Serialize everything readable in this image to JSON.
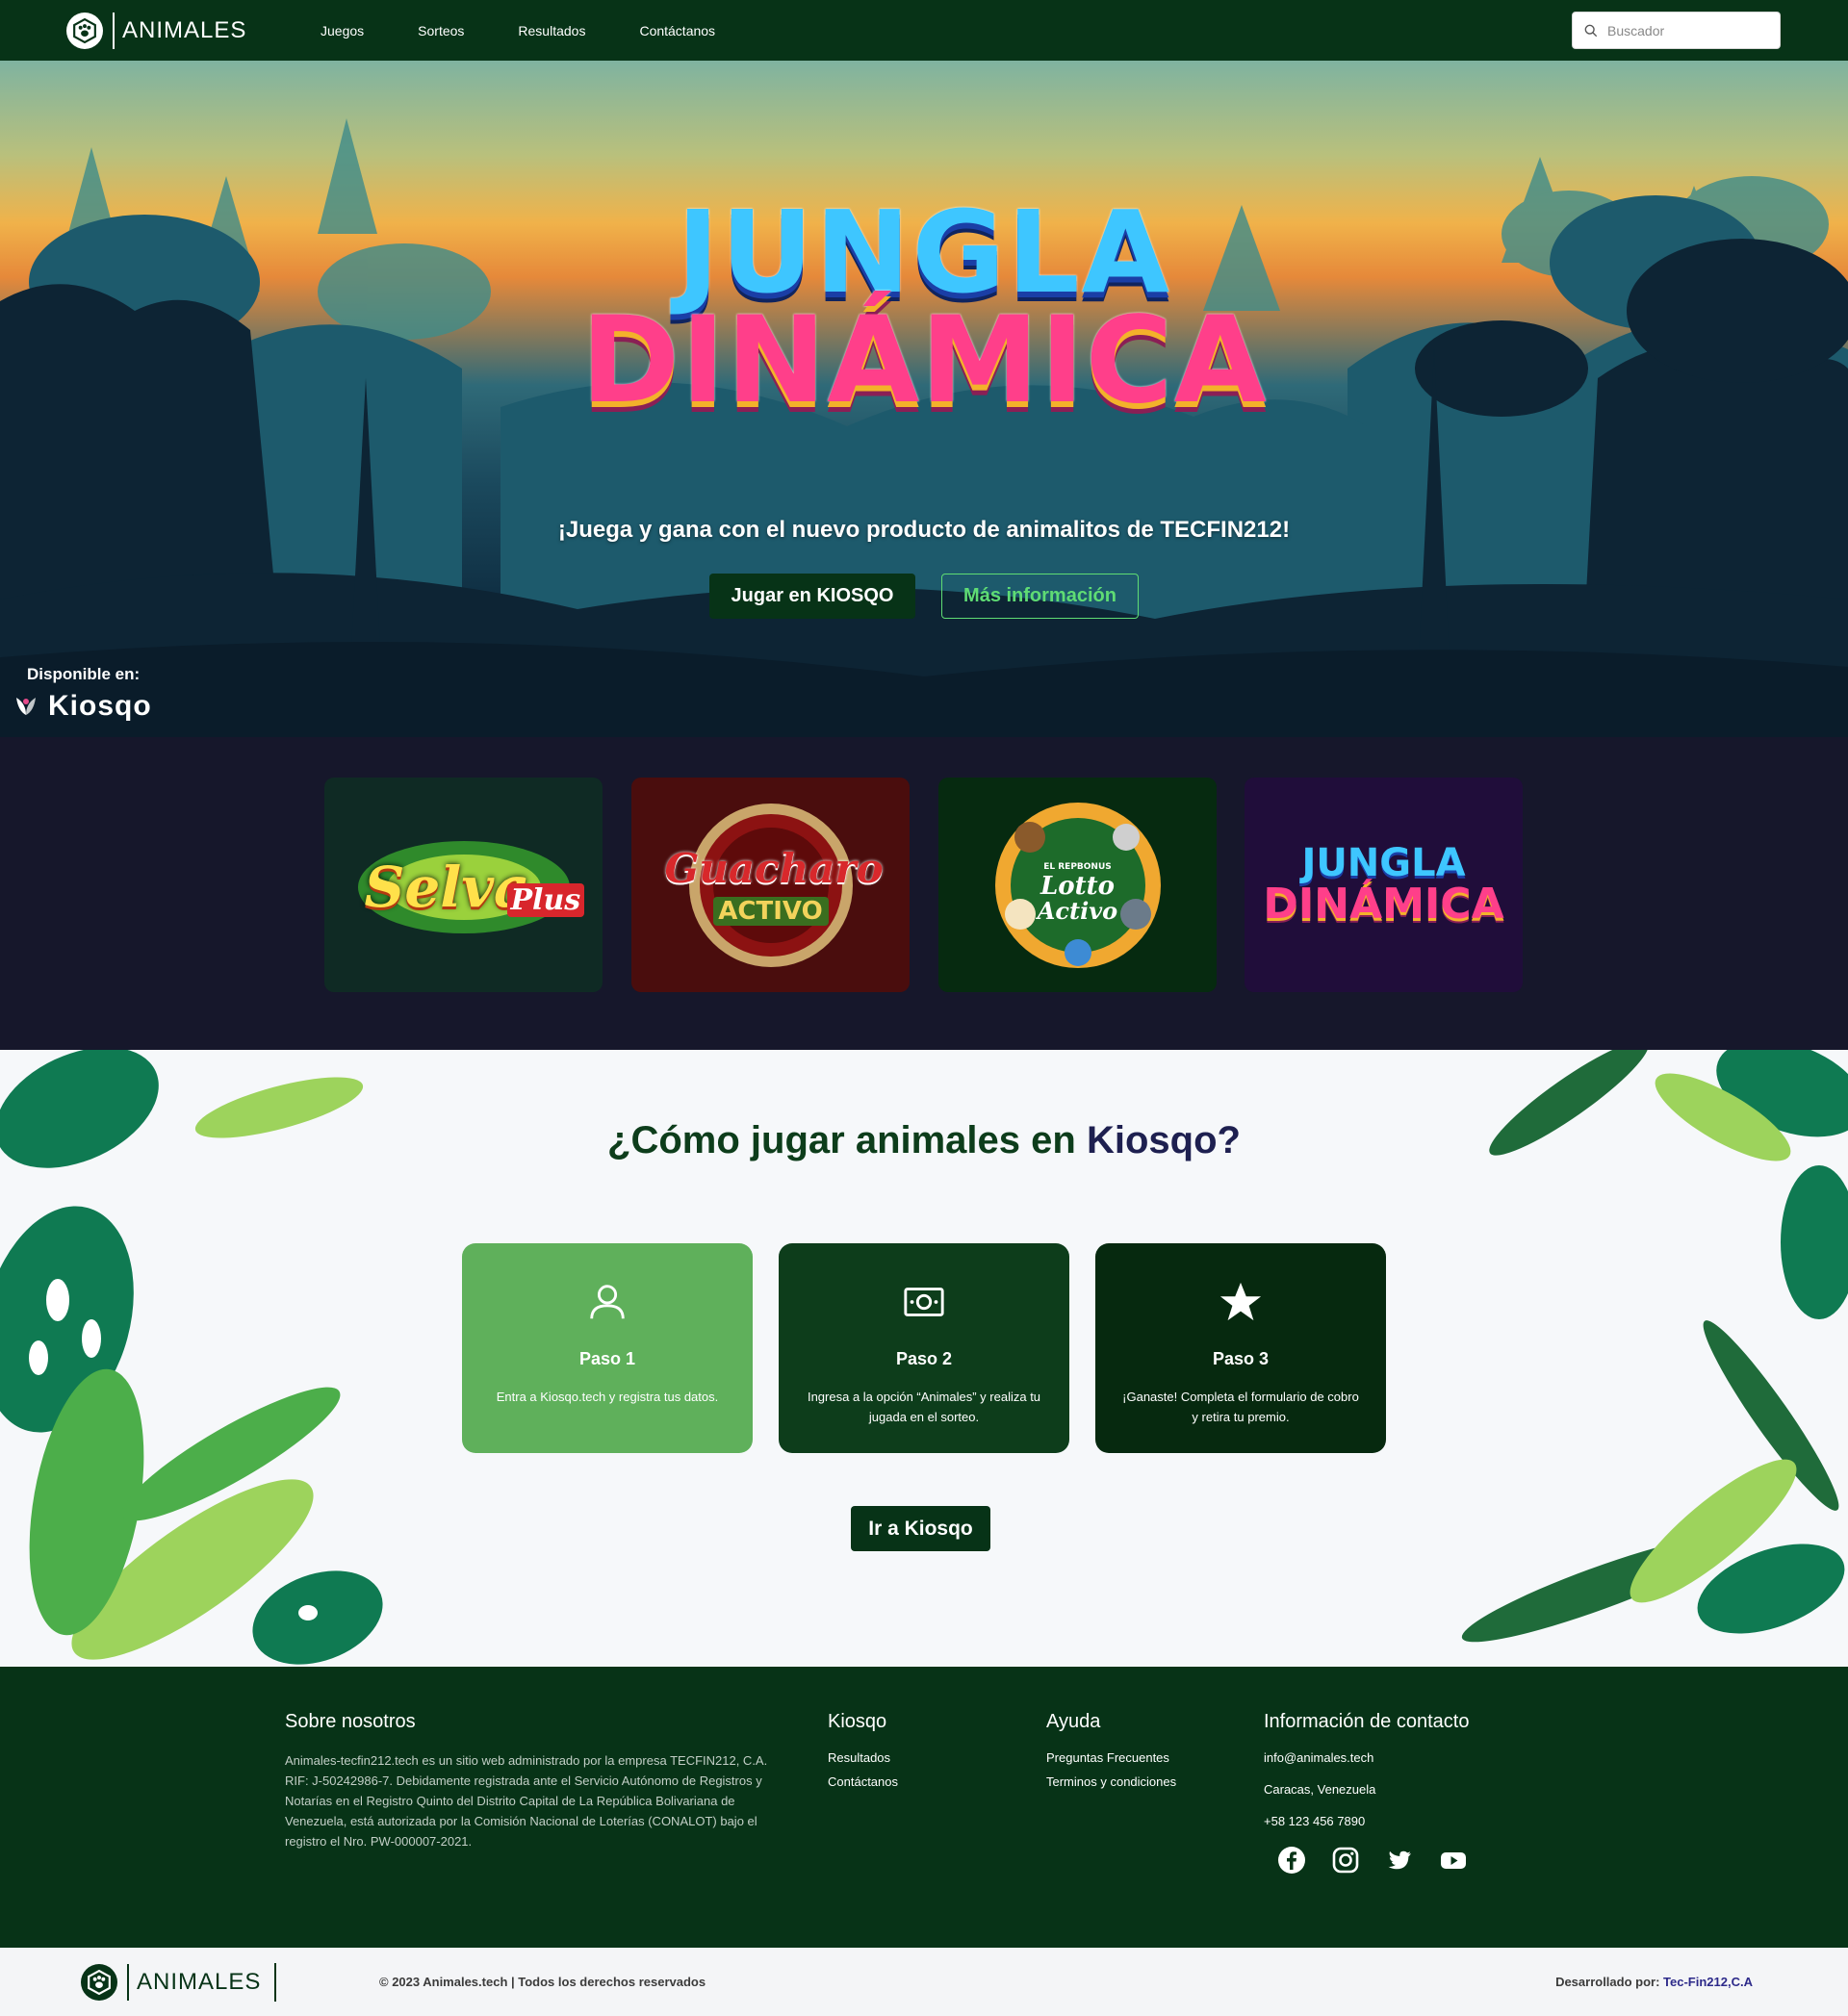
{
  "nav": {
    "brand": "ANIMALES",
    "links": [
      "Juegos",
      "Sorteos",
      "Resultados",
      "Contáctanos"
    ],
    "search_placeholder": "Buscador"
  },
  "hero": {
    "title_line1": "JUNGLA",
    "title_line2": "DINÁMICA",
    "tagline": "¡Juega y gana con el nuevo producto de animalitos de TECFIN212!",
    "primary_button": "Jugar en KIOSQO",
    "secondary_button": "Más información",
    "available_label": "Disponible en:",
    "available_brand": "Kiosqo"
  },
  "games": [
    {
      "title": "Selva",
      "subtitle": "Plus"
    },
    {
      "title": "Guacharo",
      "subtitle": "ACTIVO"
    },
    {
      "title": "Lotto",
      "subtitle": "Activo",
      "top": "EL REPBONUS"
    },
    {
      "title": "JUNGLA",
      "subtitle": "DINÁMICA"
    }
  ],
  "howto": {
    "title_main": "¿Cómo jugar animales en",
    "title_accent": "Kiosqo?",
    "steps": [
      {
        "title": "Paso 1",
        "desc": "Entra a Kiosqo.tech y registra tus datos.",
        "icon": "user-icon",
        "color": "#5fb05b"
      },
      {
        "title": "Paso 2",
        "desc": "Ingresa a la opción “Animales” y realiza tu jugada en el sorteo.",
        "icon": "money-icon",
        "color": "#0d3d1b"
      },
      {
        "title": "Paso 3",
        "desc": "¡Ganaste! Completa el formulario de cobro y retira tu premio.",
        "icon": "star-icon",
        "color": "#06290f"
      }
    ],
    "button": "Ir a Kiosqo"
  },
  "footer": {
    "about_title": "Sobre nosotros",
    "about_text": "Animales-tecfin212.tech es un sitio web administrado por la empresa TECFIN212, C.A. RIF: J-50242986-7. Debidamente registrada ante el Servicio Autónomo de Registros y Notarías en el Registro Quinto del Distrito Capital de La República Bolivariana de Venezuela, está autorizada por la Comisión Nacional de Loterías (CONALOT) bajo el registro el Nro. PW-000007-2021.",
    "kiosqo_title": "Kiosqo",
    "kiosqo_links": [
      "Resultados",
      "Contáctanos"
    ],
    "help_title": "Ayuda",
    "help_links": [
      "Preguntas Frecuentes",
      "Terminos y condiciones"
    ],
    "contact_title": "Información de contacto",
    "email": "info@animales.tech",
    "location": "Caracas, Venezuela",
    "phone": "+58 123 456 7890",
    "socials": [
      "facebook-icon",
      "instagram-icon",
      "twitter-icon",
      "youtube-icon"
    ]
  },
  "bottom": {
    "brand": "ANIMALES",
    "copyright": "© 2023 Animales.tech | Todos los derechos reservados",
    "dev_label": "Desarrollado por:",
    "dev_name": "Tec-Fin212,C.A"
  },
  "colors": {
    "primary_dark": "#073317",
    "accent_green": "#5fdc74",
    "games_bg": "#16172b"
  }
}
